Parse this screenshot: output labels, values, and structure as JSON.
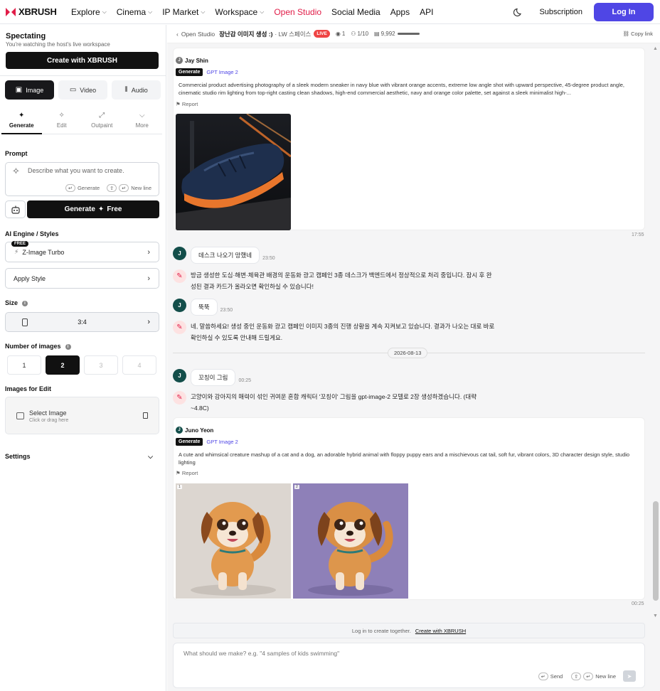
{
  "brand": {
    "name": "XBRUSH",
    "accent": "#e11d48",
    "primary": "#4f46e5"
  },
  "nav": {
    "items": [
      {
        "label": "Explore",
        "dropdown": true
      },
      {
        "label": "Cinema",
        "dropdown": true
      },
      {
        "label": "IP Market",
        "dropdown": true
      },
      {
        "label": "Workspace",
        "dropdown": true
      },
      {
        "label": "Open Studio",
        "dropdown": false,
        "active": true
      },
      {
        "label": "Social Media",
        "dropdown": false
      },
      {
        "label": "Apps",
        "dropdown": false
      },
      {
        "label": "API",
        "dropdown": false
      }
    ],
    "subscription": "Subscription",
    "login": "Log In"
  },
  "sidebar": {
    "spectating_title": "Spectating",
    "spectating_sub": "You're watching the host's live workspace",
    "create_button": "Create with XBRUSH",
    "modes": [
      "Image",
      "Video",
      "Audio"
    ],
    "subtabs": [
      "Generate",
      "Edit",
      "Outpaint",
      "More"
    ],
    "prompt_label": "Prompt",
    "prompt_placeholder": "Describe what you want to create.",
    "hint_generate": "Generate",
    "hint_newline": "New line",
    "generate_button": "Generate",
    "generate_free": "Free",
    "engine_label": "AI Engine / Styles",
    "engine_value": "Z-Image Turbo",
    "free_badge": "FREE",
    "apply_style": "Apply Style",
    "size_label": "Size",
    "size_value": "3:4",
    "num_label": "Number of images",
    "num_options": [
      "1",
      "2",
      "3",
      "4"
    ],
    "num_selected": "2",
    "images_edit_label": "Images for Edit",
    "select_image": "Select Image",
    "select_image_sub": "Click or drag here",
    "settings": "Settings"
  },
  "header": {
    "back": "Open Studio",
    "title": "장난감 이미지 생성 :)",
    "space": "· LW 스페이스",
    "live": "LIVE",
    "viewers": "1",
    "participants": "1/10",
    "credits": "9,992",
    "copy_link": "Copy link"
  },
  "feed": {
    "card1": {
      "author": "Jay Shin",
      "author_initial": "J",
      "tag": "Generate",
      "model": "GPT Image 2",
      "prompt": "Commercial product advertising photography of a sleek modern sneaker in navy blue with vibrant orange accents, extreme low angle shot with upward perspective, 45-degree product angle, cinematic studio rim lighting from top-right casting clean shadows, high-end commercial aesthetic, navy and orange color palette, set against a sleek minimalist high-...",
      "report": "Report",
      "time": "17:55"
    },
    "msg1": {
      "initial": "J",
      "text": "데스크 나오기 망했네",
      "time": "23:50"
    },
    "bot1": "방금 생성한 도심·해변·체육관 배경의 운동화 광고 캠페인 3종 데스크가 백엔드에서 정상적으로 처리 중입니다. 잠시 후 완성된 결과 카드가 올라오면 확인하실 수 있습니다!",
    "msg2": {
      "initial": "J",
      "text": "뚝뚝",
      "time": "23:50"
    },
    "bot2": "네, 말씀하세요! 생성 중인 운동화 광고 캠페인 이미지 3종의 진행 상황을 계속 지켜보고 있습니다. 결과가 나오는 대로 바로 확인하실 수 있도록 안내해 드릴게요.",
    "date": "2026-08-13",
    "msg3": {
      "initial": "J",
      "text": "꼬칭이 그림",
      "time": "00:25"
    },
    "bot3": "고양이와 강아지의 매력이 섞인 귀여운 혼합 캐릭터 '꼬칭이' 그림을 gpt-image-2 모델로 2장 생성하겠습니다. (대략 ~4.8C)",
    "card2": {
      "author": "Juno Yeon",
      "author_initial": "J",
      "tag": "Generate",
      "model": "GPT Image 2",
      "prompt": "A cute and whimsical creature mashup of a cat and a dog, an adorable hybrid animal with floppy puppy ears and a mischievous cat tail, soft fur, vibrant colors, 3D character design style, studio lighting",
      "report": "Report",
      "image_labels": [
        "1",
        "2"
      ],
      "time": "00:25"
    }
  },
  "footer": {
    "login_text": "Log in to create together.",
    "login_link": "Create with XBRUSH",
    "composer_placeholder": "What should we make? e.g. \"4 samples of kids swimming\"",
    "send": "Send",
    "newline": "New line"
  }
}
